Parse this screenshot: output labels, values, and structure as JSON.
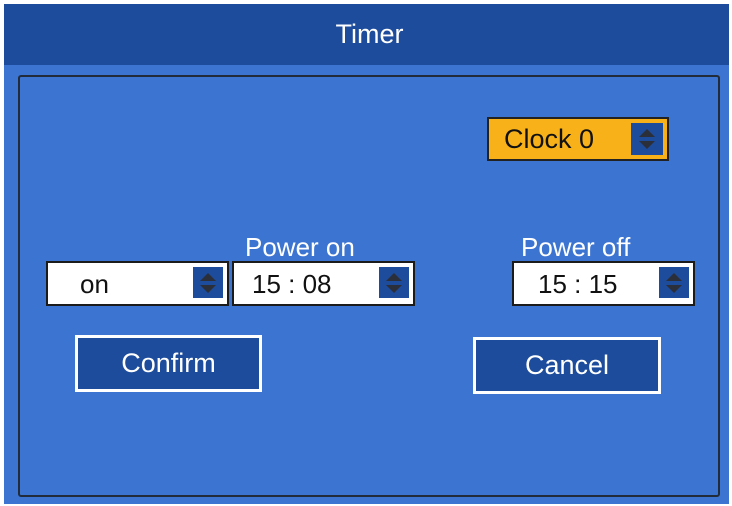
{
  "window": {
    "title": "Timer"
  },
  "clock_selector": {
    "value": "Clock 0",
    "accent_color": "#f9b11a"
  },
  "mode_selector": {
    "value": "on"
  },
  "power_on": {
    "label": "Power on",
    "time": "15 : 08"
  },
  "power_off": {
    "label": "Power off",
    "time": "15 : 15"
  },
  "buttons": {
    "confirm": "Confirm",
    "cancel": "Cancel"
  },
  "icons": {
    "spinner": "up-down-arrows-icon"
  },
  "colors": {
    "background": "#3c74d2",
    "titlebar": "#1d4c9c",
    "button": "#1d4c9c"
  }
}
